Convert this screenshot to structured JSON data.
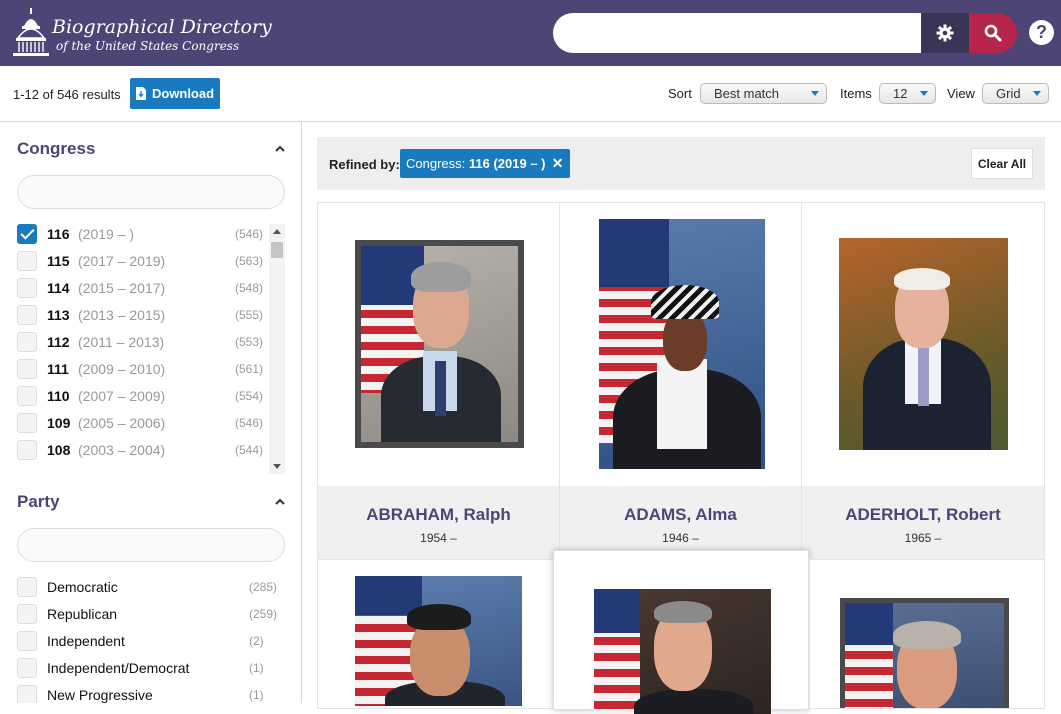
{
  "header": {
    "logo_line1": "Biographical Directory",
    "logo_line2": "of the United States Congress",
    "search_value": "",
    "help_label": "?"
  },
  "results": {
    "count_text": "1-12 of 546 results",
    "download_label": "Download",
    "sort_label": "Sort",
    "sort_value": "Best match",
    "items_label": "Items",
    "items_value": "12",
    "view_label": "View",
    "view_value": "Grid"
  },
  "congress_facet": {
    "title": "Congress",
    "items": [
      {
        "num": "116",
        "years": "(2019 – )",
        "count": "(546)",
        "checked": true
      },
      {
        "num": "115",
        "years": "(2017 – 2019)",
        "count": "(563)",
        "checked": false
      },
      {
        "num": "114",
        "years": "(2015 – 2017)",
        "count": "(548)",
        "checked": false
      },
      {
        "num": "113",
        "years": "(2013 – 2015)",
        "count": "(555)",
        "checked": false
      },
      {
        "num": "112",
        "years": "(2011 – 2013)",
        "count": "(553)",
        "checked": false
      },
      {
        "num": "111",
        "years": "(2009 – 2010)",
        "count": "(561)",
        "checked": false
      },
      {
        "num": "110",
        "years": "(2007 – 2009)",
        "count": "(554)",
        "checked": false
      },
      {
        "num": "109",
        "years": "(2005 – 2006)",
        "count": "(546)",
        "checked": false
      },
      {
        "num": "108",
        "years": "(2003 – 2004)",
        "count": "(544)",
        "checked": false
      }
    ]
  },
  "party_facet": {
    "title": "Party",
    "items": [
      {
        "label": "Democratic",
        "count": "(285)"
      },
      {
        "label": "Republican",
        "count": "(259)"
      },
      {
        "label": "Independent",
        "count": "(2)"
      },
      {
        "label": "Independent/Democrat",
        "count": "(1)"
      },
      {
        "label": "New Progressive",
        "count": "(1)"
      }
    ]
  },
  "refine": {
    "label": "Refined by:",
    "chip_prefix": "Congress:",
    "chip_value": "116  (2019 – )",
    "clear_label": "Clear All"
  },
  "cards": [
    {
      "name": "ABRAHAM, Ralph",
      "life": "1954 –"
    },
    {
      "name": "ADAMS, Alma",
      "life": "1946 –"
    },
    {
      "name": "ADERHOLT, Robert",
      "life": "1965 –"
    }
  ],
  "colors": {
    "header_bg": "#4d4576",
    "accent_blue": "#1a7abf",
    "search_red": "#b8254a"
  }
}
